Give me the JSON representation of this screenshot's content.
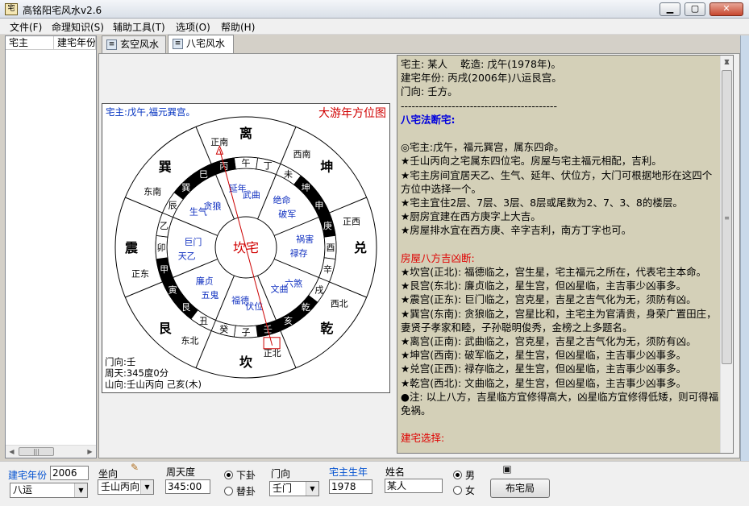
{
  "window": {
    "title": "高铭阳宅风水v2.6",
    "app_icon": "app-icon",
    "minimize": "minimize-icon",
    "maximize": "maximize-icon",
    "close": "close-icon"
  },
  "menu": [
    "文件(F)",
    "命理知识(S)",
    "辅助工具(T)",
    "选项(O)",
    "帮助(H)"
  ],
  "left_list": {
    "columns": [
      "宅主",
      "建宅年份"
    ]
  },
  "tabs": [
    {
      "label": "玄空风水",
      "icon": "document-icon"
    },
    {
      "label": "八宅风水",
      "icon": "document-icon"
    }
  ],
  "diagram": {
    "header_left": "宅主:戊午,福元巽宫。",
    "header_right": "大游年方位图",
    "center": "坎宅",
    "palaces": [
      "离",
      "坤",
      "兑",
      "乾",
      "坎",
      "艮",
      "震",
      "巽"
    ],
    "directions": [
      "正南",
      "西南",
      "正西",
      "西北",
      "正北",
      "东北",
      "正东",
      "东南"
    ],
    "mountains": [
      "午",
      "丁",
      "未",
      "坤",
      "申",
      "庚",
      "酉",
      "辛",
      "戌",
      "乾",
      "亥",
      "壬",
      "子",
      "癸",
      "丑",
      "艮",
      "寅",
      "甲",
      "卯",
      "乙",
      "辰",
      "巽",
      "巳",
      "丙"
    ],
    "stars": [
      "延年",
      "武曲",
      "绝命",
      "破军",
      "祸害",
      "禄存",
      "六煞",
      "文曲",
      "伏位",
      "福德",
      "五鬼",
      "廉贞",
      "天乙",
      "巨门",
      "生气",
      "贪狼"
    ],
    "footer": [
      "门向:壬",
      "周天:345度0分",
      "山向:壬山丙向 己亥(木)"
    ]
  },
  "report": {
    "lines": [
      {
        "t": "宅主: 某人    乾造: 戊午(1978年)。",
        "s": ""
      },
      {
        "t": "建宅年份: 丙戌(2006年)八运艮宫。",
        "s": ""
      },
      {
        "t": "门向: 壬方。",
        "s": ""
      },
      {
        "t": "-------------------------------------------",
        "s": ""
      },
      {
        "t": "八宅法断宅:",
        "s": "blue"
      },
      {
        "t": "",
        "s": ""
      },
      {
        "t": "◎宅主:戊午，福元巽宫，属东四命。",
        "s": ""
      },
      {
        "t": "★壬山丙向之宅属东四位宅。房屋与宅主福元相配，吉利。",
        "s": ""
      },
      {
        "t": "★宅主房间宜居天乙、生气、延年、伏位方，大门可根据地形在这四个方位中选择一个。",
        "s": ""
      },
      {
        "t": "★宅主宜住2层、7层、3层、8层或尾数为2、7、3、8的楼层。",
        "s": ""
      },
      {
        "t": "★厨房宜建在西方庚字上大吉。",
        "s": ""
      },
      {
        "t": "★房屋排水宜在西方庚、辛字吉利，南方丁字也可。",
        "s": ""
      },
      {
        "t": "",
        "s": ""
      },
      {
        "t": "房屋八方吉凶断:",
        "s": "red"
      },
      {
        "t": "★坎宫(正北): 福德临之，宫生星，宅主福元之所在，代表宅主本命。",
        "s": ""
      },
      {
        "t": "★艮宫(东北): 廉贞临之，星生宫，但凶星临，主吉事少凶事多。",
        "s": ""
      },
      {
        "t": "★震宫(正东): 巨门临之，宫克星，吉星之吉气化为无，须防有凶。",
        "s": ""
      },
      {
        "t": "★巽宫(东南): 贪狼临之，宫星比和，主宅主为官清贵，身荣广置田庄，妻贤子孝家和睦，子孙聪明俊秀，金榜之上多题名。",
        "s": ""
      },
      {
        "t": "★离宫(正南): 武曲临之，宫克星，吉星之吉气化为无，须防有凶。",
        "s": ""
      },
      {
        "t": "★坤宫(西南): 破军临之，星生宫，但凶星临，主吉事少凶事多。",
        "s": ""
      },
      {
        "t": "★兑宫(正西): 禄存临之，星生宫，但凶星临，主吉事少凶事多。",
        "s": ""
      },
      {
        "t": "★乾宫(西北): 文曲临之，星生宫，但凶星临，主吉事少凶事多。",
        "s": ""
      },
      {
        "t": "●注: 以上八方，吉星临方宜修得高大，凶星临方宜修得低矮，则可得福免祸。",
        "s": ""
      },
      {
        "t": "",
        "s": ""
      },
      {
        "t": "建宅选择:",
        "s": "red"
      }
    ]
  },
  "bottom": {
    "build_year_label": "建宅年份",
    "build_year_value": "2006",
    "yun_value": "八运",
    "sit_label": "坐向",
    "sit_value": "壬山丙向",
    "degree_label": "周天度",
    "degree_value": "345:00",
    "radio_xia": "下卦",
    "radio_ti": "替卦",
    "door_label": "门向",
    "door_value": "壬门",
    "birth_label": "宅主生年",
    "birth_value": "1978",
    "name_label": "姓名",
    "name_value": "某人",
    "male": "男",
    "female": "女",
    "layout_button": "布宅局"
  }
}
